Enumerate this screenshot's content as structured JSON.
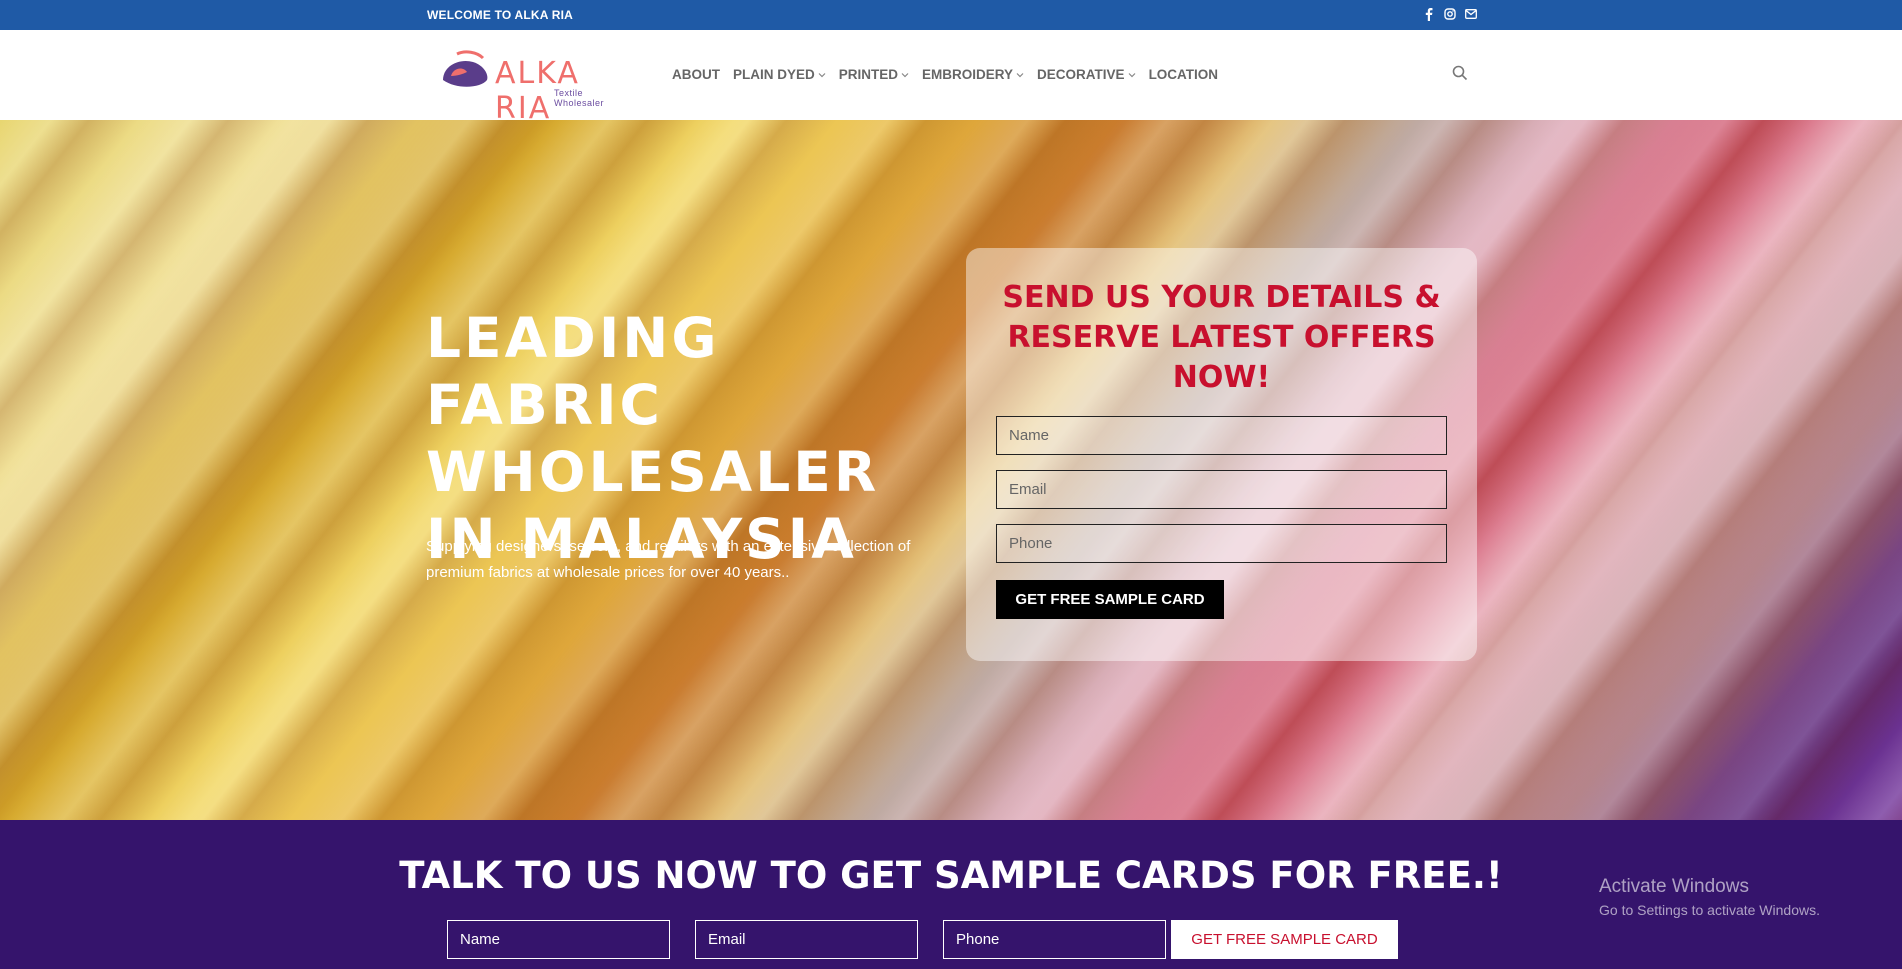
{
  "topbar": {
    "welcome": "WELCOME TO ALKA RIA",
    "social_icons": [
      "facebook-icon",
      "instagram-icon",
      "email-icon"
    ]
  },
  "header": {
    "logo_brand": "ALKA RIA",
    "logo_tagline": "Textile Wholesaler",
    "nav": [
      {
        "label": "ABOUT",
        "has_dropdown": false
      },
      {
        "label": "PLAIN DYED",
        "has_dropdown": true
      },
      {
        "label": "PRINTED",
        "has_dropdown": true
      },
      {
        "label": "EMBROIDERY",
        "has_dropdown": true
      },
      {
        "label": "DECORATIVE",
        "has_dropdown": true
      },
      {
        "label": "LOCATION",
        "has_dropdown": false
      }
    ],
    "search_icon": "search-icon"
  },
  "hero": {
    "title": "LEADING FABRIC WHOLESALER IN MALAYSIA",
    "subtitle": "Supplying designers, sewers, and retailers with an extensive collection of premium fabrics at wholesale prices for over 40 years.."
  },
  "form": {
    "title": "SEND US YOUR DETAILS & RESERVE LATEST OFFERS NOW!",
    "name_placeholder": "Name",
    "email_placeholder": "Email",
    "phone_placeholder": "Phone",
    "submit_label": "GET FREE SAMPLE CARD"
  },
  "band": {
    "title": "TALK TO US NOW TO GET SAMPLE CARDS FOR FREE.!",
    "name_placeholder": "Name",
    "email_placeholder": "Email",
    "phone_placeholder": "Phone",
    "submit_label": "GET FREE SAMPLE CARD"
  },
  "watermark": {
    "line1": "Activate Windows",
    "line2": "Go to Settings to activate Windows."
  },
  "colors": {
    "topbar": "#1f5aa6",
    "form_title": "#c8102e",
    "band": "#35146c",
    "logo": "#ef6f6c"
  }
}
